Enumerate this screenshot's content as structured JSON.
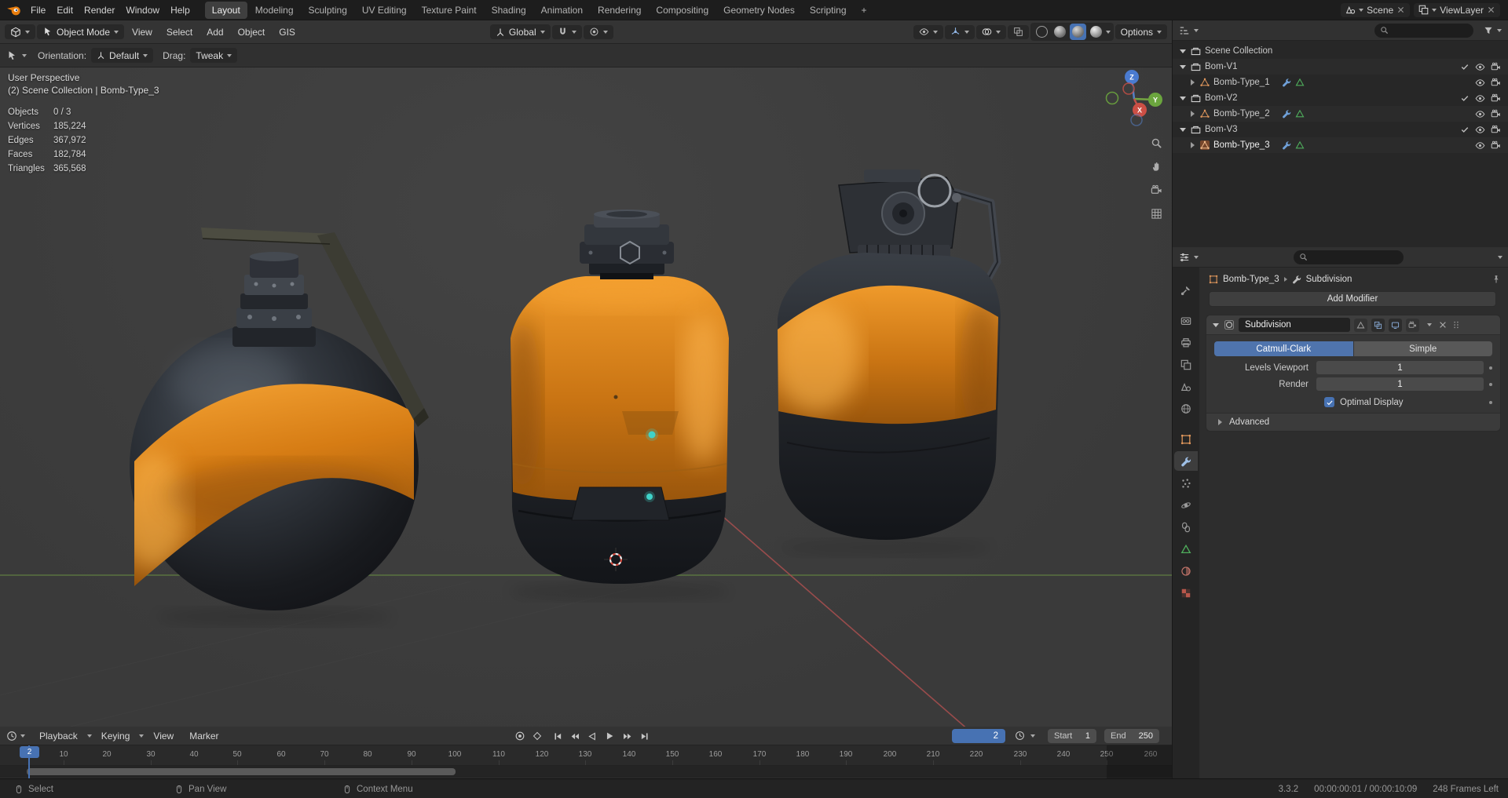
{
  "topbar": {
    "menus": [
      "File",
      "Edit",
      "Render",
      "Window",
      "Help"
    ],
    "workspaces": [
      "Layout",
      "Modeling",
      "Sculpting",
      "UV Editing",
      "Texture Paint",
      "Shading",
      "Animation",
      "Rendering",
      "Compositing",
      "Geometry Nodes",
      "Scripting"
    ],
    "add_workspace": "+",
    "scene": "Scene",
    "view_layer": "ViewLayer"
  },
  "header": {
    "mode": "Object Mode",
    "menus": [
      "View",
      "Select",
      "Add",
      "Object",
      "GIS"
    ],
    "orientation": "Global",
    "options_label": "Options"
  },
  "tool_settings": {
    "orientation_label": "Orientation:",
    "orientation_value": "Default",
    "drag_label": "Drag:",
    "drag_value": "Tweak"
  },
  "viewport": {
    "perspective": "User Perspective",
    "context": "(2) Scene Collection | Bomb-Type_3",
    "stats": {
      "labels": [
        "Objects",
        "Vertices",
        "Edges",
        "Faces",
        "Triangles"
      ],
      "values": [
        "0 / 3",
        "185,224",
        "367,972",
        "182,784",
        "365,568"
      ]
    },
    "gizmo": {
      "x": "X",
      "y": "Y",
      "z": "Z"
    }
  },
  "outliner": {
    "root_label": "Scene Collection",
    "collections": [
      {
        "name": "Bom-V1",
        "object": "Bomb-Type_1"
      },
      {
        "name": "Bom-V2",
        "object": "Bomb-Type_2"
      },
      {
        "name": "Bom-V3",
        "object": "Bomb-Type_3"
      }
    ]
  },
  "properties": {
    "breadcrumb": {
      "object": "Bomb-Type_3",
      "modifier": "Subdivision"
    },
    "add_modifier_label": "Add Modifier",
    "modifier": {
      "name": "Subdivision",
      "type_options": [
        "Catmull-Clark",
        "Simple"
      ],
      "active_type": "Catmull-Clark",
      "levels_viewport_label": "Levels Viewport",
      "levels_viewport_value": "1",
      "render_label": "Render",
      "render_value": "1",
      "optimal_display_label": "Optimal Display",
      "advanced_label": "Advanced"
    }
  },
  "timeline": {
    "menus": [
      "Playback",
      "Keying",
      "View",
      "Marker"
    ],
    "current_frame": "2",
    "start_label": "Start",
    "start_value": "1",
    "end_label": "End",
    "end_value": "250",
    "ticks": [
      "10",
      "20",
      "30",
      "40",
      "50",
      "60",
      "70",
      "80",
      "90",
      "100",
      "110",
      "120",
      "130",
      "140",
      "150",
      "160",
      "170",
      "180",
      "190",
      "200",
      "210",
      "220",
      "230",
      "240",
      "250",
      "260"
    ]
  },
  "status": {
    "items": [
      "Select",
      "Pan View",
      "Context Menu"
    ],
    "version": "3.3.2",
    "timecode": "00:00:00:01 / 00:00:10:09",
    "frames_left": "248 Frames Left"
  },
  "colors": {
    "accent": "#4772b3",
    "orange": "#e87d0d"
  }
}
